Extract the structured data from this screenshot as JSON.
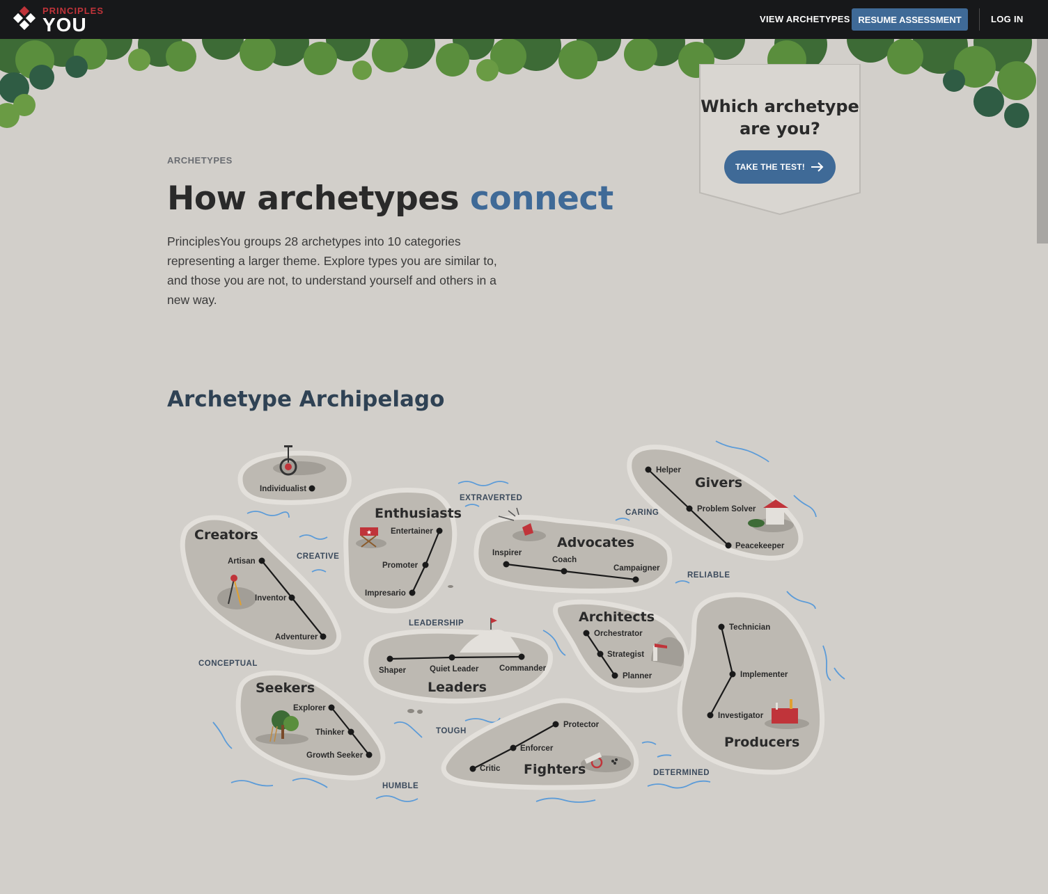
{
  "nav": {
    "logo_top": "PRINCIPLES",
    "logo_bottom": "YOU",
    "view_archetypes": "VIEW ARCHETYPES",
    "resume_assessment": "RESUME ASSESSMENT",
    "log_in": "LOG IN"
  },
  "banner": {
    "title_line1": "Which archetype",
    "title_line2": "are you?",
    "cta": "TAKE THE TEST!"
  },
  "intro": {
    "eyebrow": "ARCHETYPES",
    "title_main": "How archetypes ",
    "title_accent": "connect",
    "body": "PrinciplesYou groups 28 archetypes into 10 categories representing a larger theme. Explore types you are similar to, and those you are not, to understand yourself and others in a new way."
  },
  "map": {
    "heading": "Archetype Archipelago",
    "categories": {
      "individualist": "Individualist",
      "creators": "Creators",
      "enthusiasts": "Enthusiasts",
      "advocates": "Advocates",
      "givers": "Givers",
      "architects": "Architects",
      "leaders": "Leaders",
      "seekers": "Seekers",
      "fighters": "Fighters",
      "producers": "Producers"
    },
    "archetypes": {
      "artisan": "Artisan",
      "inventor": "Inventor",
      "adventurer": "Adventurer",
      "entertainer": "Entertainer",
      "promoter": "Promoter",
      "impresario": "Impresario",
      "inspirer": "Inspirer",
      "coach": "Coach",
      "campaigner": "Campaigner",
      "helper": "Helper",
      "problem_solver": "Problem Solver",
      "peacekeeper": "Peacekeeper",
      "orchestrator": "Orchestrator",
      "strategist": "Strategist",
      "planner": "Planner",
      "shaper": "Shaper",
      "quiet_leader": "Quiet Leader",
      "commander": "Commander",
      "explorer": "Explorer",
      "thinker": "Thinker",
      "growth_seeker": "Growth Seeker",
      "protector": "Protector",
      "enforcer": "Enforcer",
      "critic": "Critic",
      "technician": "Technician",
      "implementer": "Implementer",
      "investigator": "Investigator"
    },
    "traits": {
      "extraverted": "EXTRAVERTED",
      "caring": "CARING",
      "creative": "CREATIVE",
      "reliable": "RELIABLE",
      "leadership": "LEADERSHIP",
      "conceptual": "CONCEPTUAL",
      "tough": "TOUGH",
      "determined": "DETERMINED",
      "humble": "HUMBLE"
    }
  }
}
